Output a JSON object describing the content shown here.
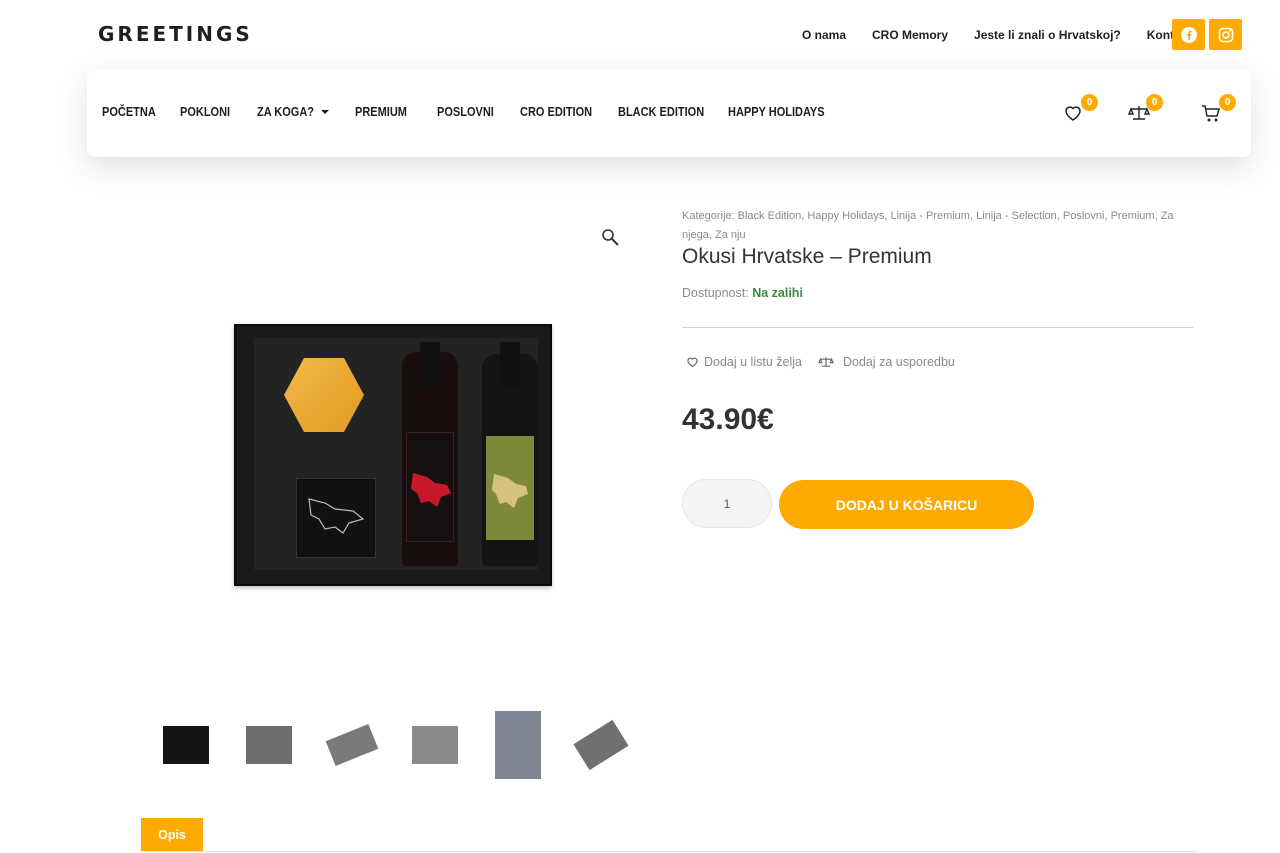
{
  "brand": {
    "logo": "GREETINGS",
    "accent": "#ffaa00"
  },
  "top_links": [
    "O nama",
    "CRO Memory",
    "Jeste li znali o Hrvatskoj?",
    "Kontakt"
  ],
  "social": [
    "facebook-icon",
    "instagram-icon"
  ],
  "nav": {
    "items": [
      "POČETNA",
      "POKLONI",
      "ZA KOGA?",
      "PREMIUM",
      "POSLOVNI",
      "CRO EDITION",
      "BLACK EDITION",
      "HAPPY HOLIDAYS"
    ],
    "wishlist_count": "0",
    "compare_count": "0",
    "cart_count": "0"
  },
  "product": {
    "categories": "Kategorije: Black Edition, Happy Holidays, Linija - Premium, Linija - Selection, Poslovni, Premium, Za njega, Za nju",
    "title": "Okusi Hrvatske – Premium",
    "stock_label": "Dostupnost:",
    "stock_value": "Na zalihi",
    "wishlist_label": "Dodaj u listu želja",
    "compare_label": "Dodaj za usporedbu",
    "price": "43.90€",
    "quantity": "1",
    "add_to_cart": "DODAJ U KOŠARICU"
  },
  "tabs": {
    "description": "Opis"
  }
}
